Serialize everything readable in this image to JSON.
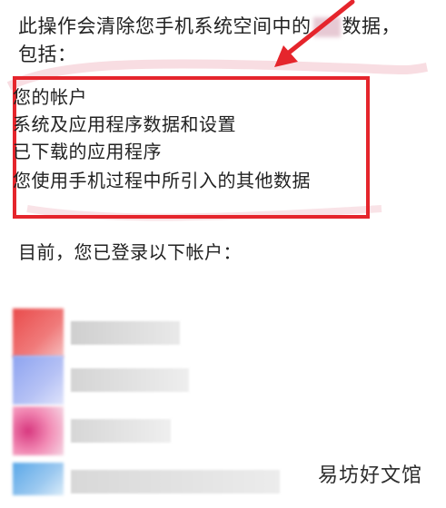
{
  "dialog": {
    "intro_text_a": "此操作会清除您手机系统空间中的",
    "intro_text_b": "数据，包括：",
    "items": [
      "您的帐户",
      "系统及应用程序数据和设置",
      "已下载的应用程序",
      "您使用手机过程中所引入的其他数据"
    ],
    "current_accounts_label": "目前，您已登录以下帐户："
  },
  "annotation": {
    "box_color": "#e5252c",
    "arrow_color": "#e5252c"
  },
  "accounts": [
    {
      "icon_color": "#e94b4b"
    },
    {
      "icon_color": "#8da3f0"
    },
    {
      "icon_color": "#d8387f"
    },
    {
      "icon_color": "#5aa8e8"
    }
  ],
  "watermark": "易坊好文馆"
}
